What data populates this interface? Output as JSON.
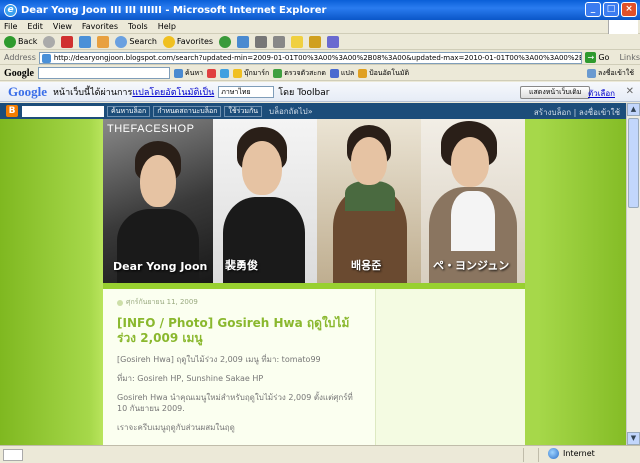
{
  "window": {
    "title": "Dear Yong Joon III III IIIIII - Microsoft Internet Explorer",
    "icon": "ie-icon"
  },
  "menu": [
    "File",
    "Edit",
    "View",
    "Favorites",
    "Tools",
    "Help"
  ],
  "toolbar": {
    "back": "Back",
    "search": "Search",
    "favorites": "Favorites"
  },
  "address": {
    "label": "Address",
    "url": "http://dearyongjoon.blogspot.com/search?updated-min=2009-01-01T00%3A00%3A00%2B08%3A00&updated-max=2010-01-01T00%3A00%3A00%2B08%3A00&max-results=50",
    "go": "Go",
    "links": "Links"
  },
  "google_toolbar": {
    "logo": "Google",
    "search_btn": "ค้นหา",
    "bookmarks": "บุ๊กมาร์ก",
    "spellcheck": "ตรวจตัวสะกด",
    "translate": "แปล",
    "autofill": "ป้อนอัตโนมัติ",
    "signin": "ลงชื่อเข้าใช้"
  },
  "translate_bar": {
    "logo": "Google",
    "msg_prefix": "หน้าเว็บนี้ได้ผ่านการ",
    "msg_link": "แปลโดยอัตโนมัติเป็น",
    "language": "ภาษาไทย",
    "msg_suffix": "โดย Toolbar",
    "show_original": "แสดงหน้าเว็บเดิม",
    "options": "ตัวเลือก"
  },
  "navbar": {
    "search_btn": "ค้นหาบล็อก",
    "flag_btn": "กำหนดสถานะบล็อก",
    "share_btn": "ใช้ร่วมกัน",
    "next_blog": "บล็อกถัดไป»",
    "create_blog": "สร้างบล็อก",
    "signin": "ลงชื่อเข้าใช้"
  },
  "header": {
    "brand": "THEFACESHOP",
    "captions": [
      "Dear Yong Joon",
      "裴勇俊",
      "배용준",
      "ペ・ヨンジュン"
    ]
  },
  "post": {
    "date": "ศุกร์กันยายน 11, 2009",
    "title": "[INFO / Photo] Gosireh Hwa ฤดูใบไม้ร่วง 2,009 เมนู",
    "paragraphs": [
      "[Gosireh Hwa] ฤดูใบไม้ร่วง 2,009 เมนู ที่มา: tomato99",
      "ที่มา: Gosireh HP, Sunshine Sakae HP",
      "Gosireh Hwa นำคุณเมนูใหม่สำหรับฤดูใบไม้ร่วง 2,009 ตั้งแต่ศุกร์ที่ 10 กันยายน 2009.",
      "เราจะครีบเมนูฤดูกับส่วนผสมในฤดู"
    ]
  },
  "status": {
    "zone": "Internet"
  }
}
